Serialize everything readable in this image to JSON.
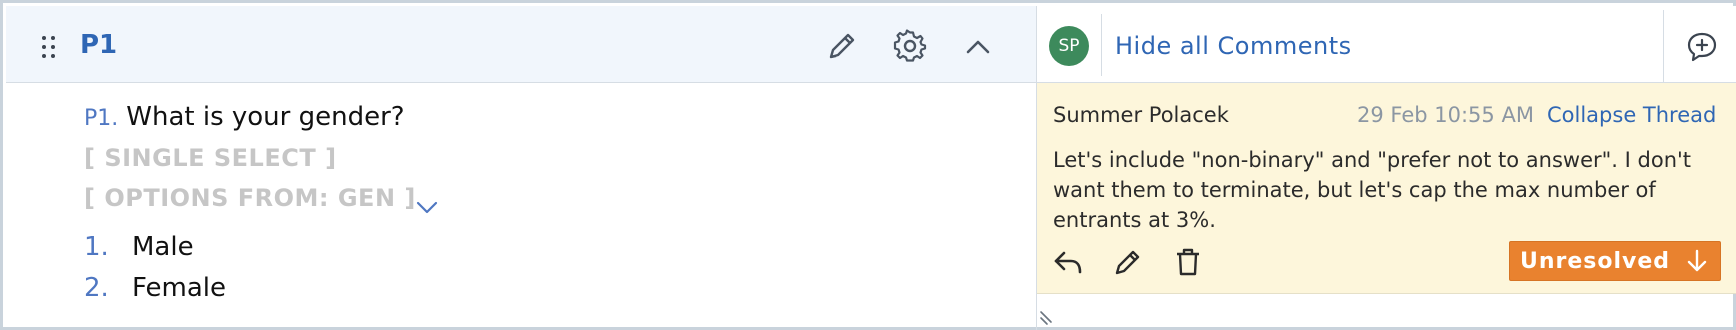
{
  "question": {
    "id": "P1",
    "number_label": "P1.",
    "text": "What is your gender?",
    "tags": [
      "[ SINGLE SELECT ]",
      "[ OPTIONS FROM: GEN ]"
    ],
    "options": [
      {
        "number": "1.",
        "label": "Male"
      },
      {
        "number": "2.",
        "label": "Female"
      }
    ]
  },
  "header_icons": [
    "drag-handle-icon",
    "pencil-icon",
    "gear-icon",
    "chevron-up-icon"
  ],
  "comments_panel": {
    "avatar_initials": "SP",
    "hide_label": "Hide all Comments",
    "add_icon": "add-comment-icon",
    "thread": {
      "author": "Summer Polacek",
      "timestamp": "29 Feb 10:55 AM",
      "collapse_label": "Collapse Thread",
      "body": "Let's include \"non-binary\" and \"prefer not to answer\". I don't want them to terminate, but let's cap the max number of entrants at 3%.",
      "actions": [
        "reply-icon",
        "edit-icon",
        "trash-icon"
      ],
      "status_label": "Unresolved"
    }
  },
  "colors": {
    "accent": "#2f66b4",
    "header_bg": "#f1f6fc",
    "thread_bg": "#fdf6db",
    "status_orange": "#e9822f",
    "avatar_green": "#3d8a5c",
    "tag_gray": "#c6c6c6"
  }
}
